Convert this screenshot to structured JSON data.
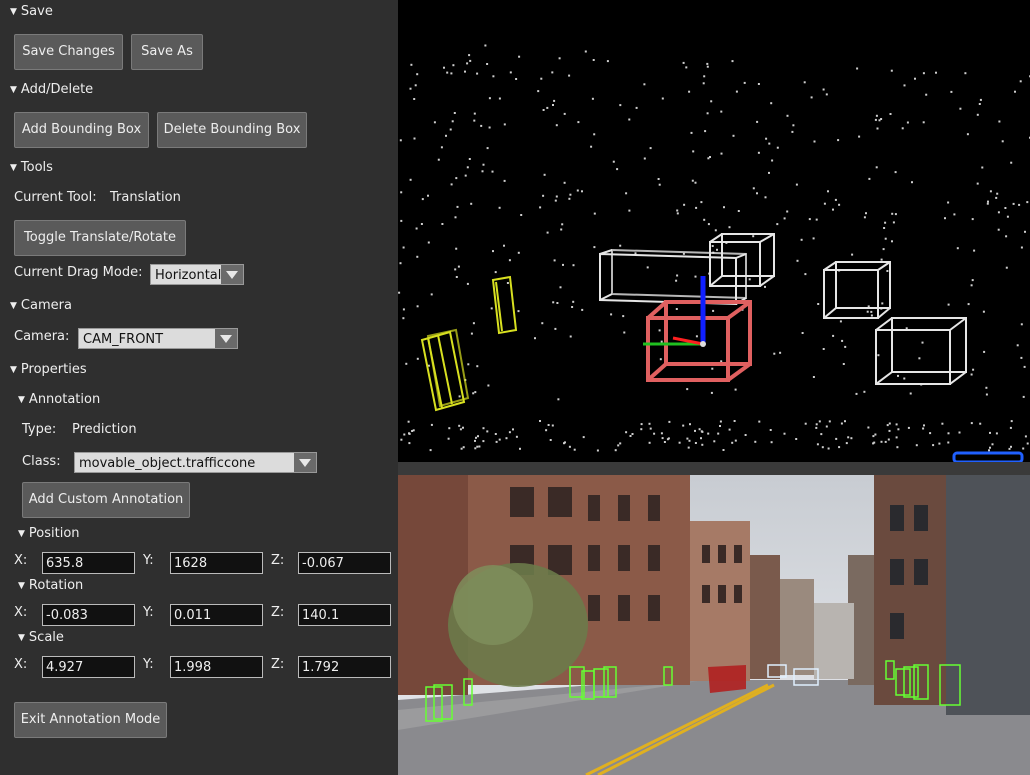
{
  "save": {
    "header": "Save",
    "save_changes": "Save Changes",
    "save_as": "Save As"
  },
  "add_delete": {
    "header": "Add/Delete",
    "add_box": "Add Bounding Box",
    "delete_box": "Delete Bounding Box"
  },
  "tools": {
    "header": "Tools",
    "current_tool_label": "Current Tool:",
    "current_tool_value": "Translation",
    "toggle": "Toggle Translate/Rotate",
    "drag_mode_label": "Current Drag Mode:",
    "drag_mode_value": "Horizontal"
  },
  "camera": {
    "header": "Camera",
    "camera_label": "Camera:",
    "camera_value": "CAM_FRONT"
  },
  "properties": {
    "header": "Properties",
    "annotation": {
      "header": "Annotation",
      "type_label": "Type:",
      "type_value": "Prediction",
      "class_label": "Class:",
      "class_value": "movable_object.trafficcone",
      "add_custom": "Add Custom Annotation"
    },
    "position": {
      "header": "Position",
      "x_label": "X:",
      "y_label": "Y:",
      "z_label": "Z:",
      "x": "635.8",
      "y": "1628",
      "z": "-0.067"
    },
    "rotation": {
      "header": "Rotation",
      "x_label": "X:",
      "y_label": "Y:",
      "z_label": "Z:",
      "x": "-0.083",
      "y": "0.011",
      "z": "140.1"
    },
    "scale": {
      "header": "Scale",
      "x_label": "X:",
      "y_label": "Y:",
      "z_label": "Z:",
      "x": "4.927",
      "y": "1.998",
      "z": "1.792"
    }
  },
  "exit": "Exit Annotation Mode",
  "colors": {
    "panel_bg": "#2f2f2f",
    "button_bg": "#5a5a5a",
    "box_white": "#e6e6e6",
    "box_selected": "#e06060",
    "box_yellow": "#d8e020",
    "gizmo_blue": "#1020ff",
    "gizmo_green": "#20c020",
    "cam_box_green": "#66ff33",
    "cam_box_red": "#b02020"
  }
}
